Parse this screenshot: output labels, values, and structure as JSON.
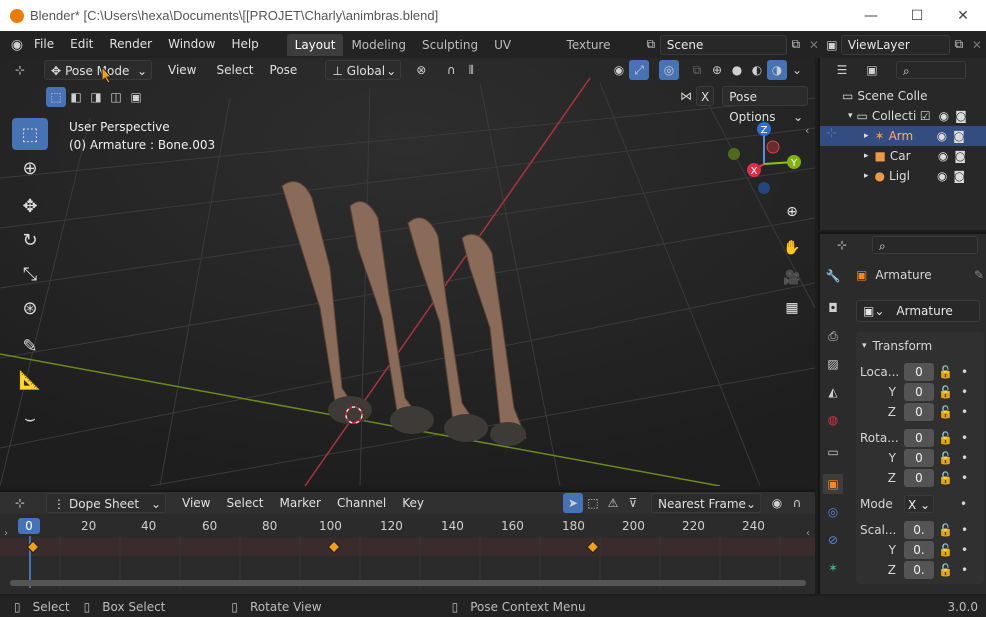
{
  "window": {
    "title": "Blender* [C:\\Users\\hexa\\Documents\\[[PROJET\\Charly\\animbras.blend]",
    "minimize": "—",
    "maximize": "☐",
    "close": "✕"
  },
  "menubar": {
    "items": [
      "File",
      "Edit",
      "Render",
      "Window",
      "Help"
    ],
    "workspaces": [
      "Layout",
      "Modeling",
      "Sculpting",
      "UV Editing",
      "Texture Pair"
    ],
    "active_workspace": "Layout",
    "scene_name": "Scene",
    "view_layer_name": "ViewLayer"
  },
  "viewport": {
    "mode": "Pose Mode",
    "menus": [
      "View",
      "Select",
      "Pose"
    ],
    "orientation": "Global",
    "pose_options": "Pose Options",
    "overlay_text_1": "User Perspective",
    "overlay_text_2": "(0) Armature : Bone.003",
    "x_button": "X",
    "gizmo": {
      "z": "Z",
      "y": "Y",
      "x": "X"
    },
    "accent_color": "#4772b3"
  },
  "toolbar_tools": [
    "select-box",
    "cursor",
    "move",
    "rotate",
    "scale",
    "transform",
    "annotate",
    "measure",
    "relax"
  ],
  "dopesheet": {
    "editor": "Dope Sheet",
    "menus": [
      "View",
      "Select",
      "Marker",
      "Channel",
      "Key"
    ],
    "snap": "Nearest Frame",
    "current_frame": "0",
    "frame_labels": [
      "20",
      "40",
      "60",
      "80",
      "100",
      "120",
      "140",
      "160",
      "180",
      "200",
      "220",
      "240"
    ],
    "keyframes": [
      1,
      101,
      187
    ]
  },
  "outliner": {
    "rows": [
      {
        "label": "Scene Colle",
        "icon": "collection-icon"
      },
      {
        "label": "Collecti",
        "icon": "collection-icon"
      },
      {
        "label": "Arm",
        "icon": "armature-icon",
        "selected": true
      },
      {
        "label": "Car",
        "icon": "camera-icon"
      },
      {
        "label": "Ligl",
        "icon": "light-icon"
      }
    ]
  },
  "properties": {
    "object_name": "Armature",
    "data_name": "Armature",
    "section": "Transform",
    "location_label": "Loca...",
    "rotation_label": "Rota...",
    "scale_label": "Scal...",
    "y_label": "Y",
    "z_label": "Z",
    "mode_label": "Mode",
    "mode_value": "X",
    "loc": [
      "0",
      "0",
      "0"
    ],
    "rot": [
      "0",
      "0",
      "0"
    ],
    "scale": [
      "0.",
      "0.",
      "0."
    ]
  },
  "statusbar": {
    "select": "Select",
    "box_select": "Box Select",
    "rotate_view": "Rotate View",
    "context_menu": "Pose Context Menu",
    "version": "3.0.0"
  }
}
